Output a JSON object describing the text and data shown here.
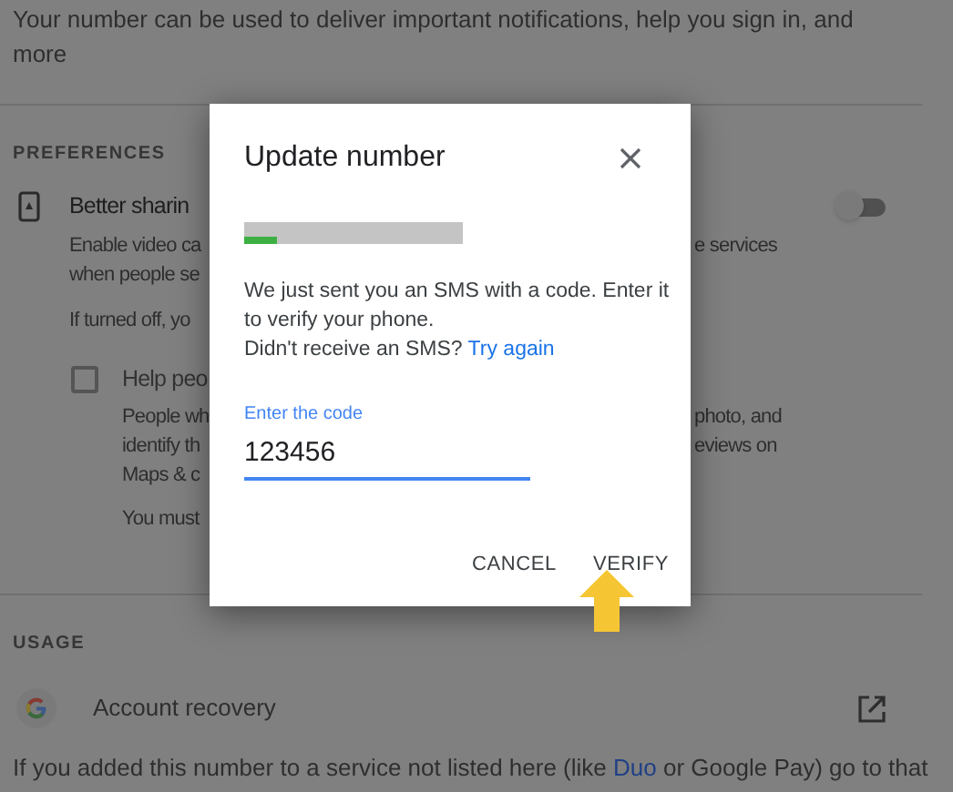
{
  "intro": "Your number can be used to deliver important notifications, help you sign in, and more",
  "preferences": {
    "heading": "PREFERENCES",
    "better_sharing": {
      "title": "Better sharin",
      "on": false,
      "lines": [
        {
          "left": "Enable video ca",
          "right": "e services"
        },
        {
          "left": "when people se"
        }
      ],
      "note": "If turned off, yo"
    },
    "help_people": {
      "title": "Help peo",
      "checked": false,
      "lines": [
        {
          "left": "People wh",
          "right": "photo, and"
        },
        {
          "left": "identify th",
          "right": "eviews on"
        },
        {
          "left": "Maps & c"
        }
      ],
      "note": "You must"
    }
  },
  "usage": {
    "heading": "USAGE",
    "items": [
      {
        "label": "Account recovery"
      }
    ]
  },
  "footer": {
    "before": "If you added this number to a service not listed here (like ",
    "link": "Duo",
    "after": " or Google Pay) go to that"
  },
  "dialog": {
    "title": "Update number",
    "message": "We just sent you an SMS with a code. Enter it to verify your phone.",
    "retry_prompt": "Didn't receive an SMS?",
    "retry_link": "Try again",
    "code_field": {
      "label": "Enter the code",
      "value": "123456"
    },
    "buttons": [
      {
        "label": "CANCEL"
      },
      {
        "label": "VERIFY"
      }
    ]
  }
}
